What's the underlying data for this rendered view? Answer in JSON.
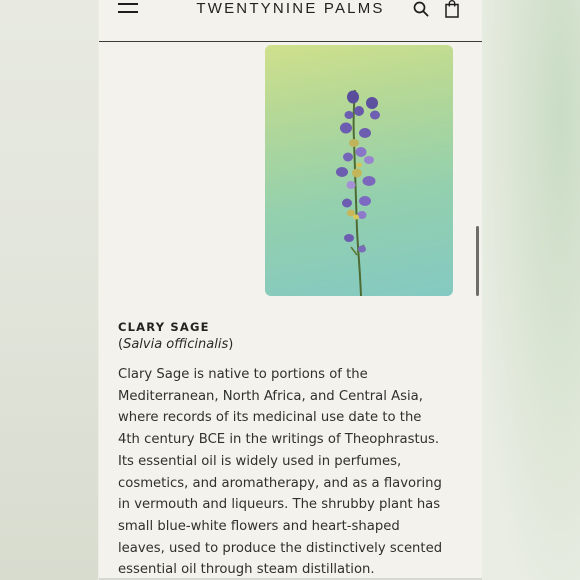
{
  "header": {
    "brand": "TWENTYNINE PALMS",
    "menu_icon": "hamburger-menu-icon",
    "search_icon": "search-icon",
    "bag_icon": "shopping-bag-icon"
  },
  "product_image": {
    "subject": "lavender-sprig",
    "colors": {
      "bg_top": "#cfe08c",
      "bg_bottom": "#84c9c2",
      "flower": "#6a5aa8",
      "stem": "#4e6b33"
    }
  },
  "section": {
    "title": "CLARY SAGE",
    "latin_open": "(",
    "latin_name": "Salvia officinalis",
    "latin_close": ")",
    "body_lines": [
      "Clary Sage is native to portions of the",
      "Mediterranean, North Africa, and Central Asia,",
      "where records of its medicinal use date to the",
      "4th century BCE in the writings of Theophrastus.",
      "Its essential oil is widely used in perfumes,",
      "cosmetics, and aromatherapy, and as a flavoring",
      "in vermouth and liqueurs. The shrubby plant has",
      "small blue-white flowers and heart-shaped",
      "leaves, used to produce the distinctively scented",
      "essential oil through steam distillation."
    ]
  }
}
